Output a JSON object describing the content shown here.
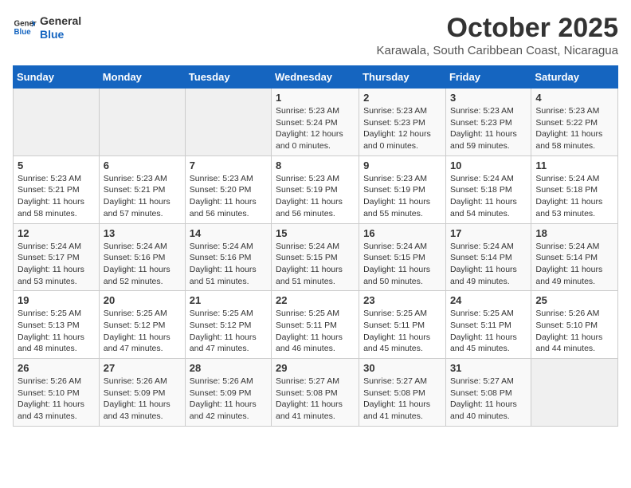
{
  "header": {
    "logo_general": "General",
    "logo_blue": "Blue",
    "month": "October 2025",
    "location": "Karawala, South Caribbean Coast, Nicaragua"
  },
  "days_of_week": [
    "Sunday",
    "Monday",
    "Tuesday",
    "Wednesday",
    "Thursday",
    "Friday",
    "Saturday"
  ],
  "weeks": [
    [
      {
        "day": "",
        "sunrise": "",
        "sunset": "",
        "daylight": ""
      },
      {
        "day": "",
        "sunrise": "",
        "sunset": "",
        "daylight": ""
      },
      {
        "day": "",
        "sunrise": "",
        "sunset": "",
        "daylight": ""
      },
      {
        "day": "1",
        "sunrise": "Sunrise: 5:23 AM",
        "sunset": "Sunset: 5:24 PM",
        "daylight": "Daylight: 12 hours and 0 minutes."
      },
      {
        "day": "2",
        "sunrise": "Sunrise: 5:23 AM",
        "sunset": "Sunset: 5:23 PM",
        "daylight": "Daylight: 12 hours and 0 minutes."
      },
      {
        "day": "3",
        "sunrise": "Sunrise: 5:23 AM",
        "sunset": "Sunset: 5:23 PM",
        "daylight": "Daylight: 11 hours and 59 minutes."
      },
      {
        "day": "4",
        "sunrise": "Sunrise: 5:23 AM",
        "sunset": "Sunset: 5:22 PM",
        "daylight": "Daylight: 11 hours and 58 minutes."
      }
    ],
    [
      {
        "day": "5",
        "sunrise": "Sunrise: 5:23 AM",
        "sunset": "Sunset: 5:21 PM",
        "daylight": "Daylight: 11 hours and 58 minutes."
      },
      {
        "day": "6",
        "sunrise": "Sunrise: 5:23 AM",
        "sunset": "Sunset: 5:21 PM",
        "daylight": "Daylight: 11 hours and 57 minutes."
      },
      {
        "day": "7",
        "sunrise": "Sunrise: 5:23 AM",
        "sunset": "Sunset: 5:20 PM",
        "daylight": "Daylight: 11 hours and 56 minutes."
      },
      {
        "day": "8",
        "sunrise": "Sunrise: 5:23 AM",
        "sunset": "Sunset: 5:19 PM",
        "daylight": "Daylight: 11 hours and 56 minutes."
      },
      {
        "day": "9",
        "sunrise": "Sunrise: 5:23 AM",
        "sunset": "Sunset: 5:19 PM",
        "daylight": "Daylight: 11 hours and 55 minutes."
      },
      {
        "day": "10",
        "sunrise": "Sunrise: 5:24 AM",
        "sunset": "Sunset: 5:18 PM",
        "daylight": "Daylight: 11 hours and 54 minutes."
      },
      {
        "day": "11",
        "sunrise": "Sunrise: 5:24 AM",
        "sunset": "Sunset: 5:18 PM",
        "daylight": "Daylight: 11 hours and 53 minutes."
      }
    ],
    [
      {
        "day": "12",
        "sunrise": "Sunrise: 5:24 AM",
        "sunset": "Sunset: 5:17 PM",
        "daylight": "Daylight: 11 hours and 53 minutes."
      },
      {
        "day": "13",
        "sunrise": "Sunrise: 5:24 AM",
        "sunset": "Sunset: 5:16 PM",
        "daylight": "Daylight: 11 hours and 52 minutes."
      },
      {
        "day": "14",
        "sunrise": "Sunrise: 5:24 AM",
        "sunset": "Sunset: 5:16 PM",
        "daylight": "Daylight: 11 hours and 51 minutes."
      },
      {
        "day": "15",
        "sunrise": "Sunrise: 5:24 AM",
        "sunset": "Sunset: 5:15 PM",
        "daylight": "Daylight: 11 hours and 51 minutes."
      },
      {
        "day": "16",
        "sunrise": "Sunrise: 5:24 AM",
        "sunset": "Sunset: 5:15 PM",
        "daylight": "Daylight: 11 hours and 50 minutes."
      },
      {
        "day": "17",
        "sunrise": "Sunrise: 5:24 AM",
        "sunset": "Sunset: 5:14 PM",
        "daylight": "Daylight: 11 hours and 49 minutes."
      },
      {
        "day": "18",
        "sunrise": "Sunrise: 5:24 AM",
        "sunset": "Sunset: 5:14 PM",
        "daylight": "Daylight: 11 hours and 49 minutes."
      }
    ],
    [
      {
        "day": "19",
        "sunrise": "Sunrise: 5:25 AM",
        "sunset": "Sunset: 5:13 PM",
        "daylight": "Daylight: 11 hours and 48 minutes."
      },
      {
        "day": "20",
        "sunrise": "Sunrise: 5:25 AM",
        "sunset": "Sunset: 5:12 PM",
        "daylight": "Daylight: 11 hours and 47 minutes."
      },
      {
        "day": "21",
        "sunrise": "Sunrise: 5:25 AM",
        "sunset": "Sunset: 5:12 PM",
        "daylight": "Daylight: 11 hours and 47 minutes."
      },
      {
        "day": "22",
        "sunrise": "Sunrise: 5:25 AM",
        "sunset": "Sunset: 5:11 PM",
        "daylight": "Daylight: 11 hours and 46 minutes."
      },
      {
        "day": "23",
        "sunrise": "Sunrise: 5:25 AM",
        "sunset": "Sunset: 5:11 PM",
        "daylight": "Daylight: 11 hours and 45 minutes."
      },
      {
        "day": "24",
        "sunrise": "Sunrise: 5:25 AM",
        "sunset": "Sunset: 5:11 PM",
        "daylight": "Daylight: 11 hours and 45 minutes."
      },
      {
        "day": "25",
        "sunrise": "Sunrise: 5:26 AM",
        "sunset": "Sunset: 5:10 PM",
        "daylight": "Daylight: 11 hours and 44 minutes."
      }
    ],
    [
      {
        "day": "26",
        "sunrise": "Sunrise: 5:26 AM",
        "sunset": "Sunset: 5:10 PM",
        "daylight": "Daylight: 11 hours and 43 minutes."
      },
      {
        "day": "27",
        "sunrise": "Sunrise: 5:26 AM",
        "sunset": "Sunset: 5:09 PM",
        "daylight": "Daylight: 11 hours and 43 minutes."
      },
      {
        "day": "28",
        "sunrise": "Sunrise: 5:26 AM",
        "sunset": "Sunset: 5:09 PM",
        "daylight": "Daylight: 11 hours and 42 minutes."
      },
      {
        "day": "29",
        "sunrise": "Sunrise: 5:27 AM",
        "sunset": "Sunset: 5:08 PM",
        "daylight": "Daylight: 11 hours and 41 minutes."
      },
      {
        "day": "30",
        "sunrise": "Sunrise: 5:27 AM",
        "sunset": "Sunset: 5:08 PM",
        "daylight": "Daylight: 11 hours and 41 minutes."
      },
      {
        "day": "31",
        "sunrise": "Sunrise: 5:27 AM",
        "sunset": "Sunset: 5:08 PM",
        "daylight": "Daylight: 11 hours and 40 minutes."
      },
      {
        "day": "",
        "sunrise": "",
        "sunset": "",
        "daylight": ""
      }
    ]
  ]
}
